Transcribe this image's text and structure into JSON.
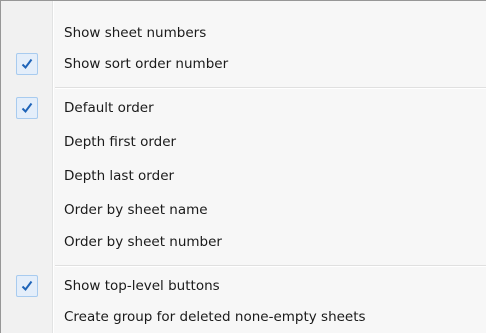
{
  "menu": {
    "items": [
      {
        "label": "Show sheet numbers",
        "checked": false
      },
      {
        "label": "Show sort order number",
        "checked": true
      },
      {
        "label": "Default order",
        "checked": true
      },
      {
        "label": "Depth first order",
        "checked": false
      },
      {
        "label": "Depth last order",
        "checked": false
      },
      {
        "label": "Order by sheet name",
        "checked": false
      },
      {
        "label": "Order by sheet number",
        "checked": false
      },
      {
        "label": "Show top-level buttons",
        "checked": true
      },
      {
        "label": "Create group for deleted none-empty sheets",
        "checked": false
      }
    ]
  },
  "colors": {
    "check_mark": "#1f64b8",
    "check_bg": "#e4eefa",
    "check_border": "#a8cbef"
  },
  "icons": {
    "check": "checkmark-icon"
  }
}
